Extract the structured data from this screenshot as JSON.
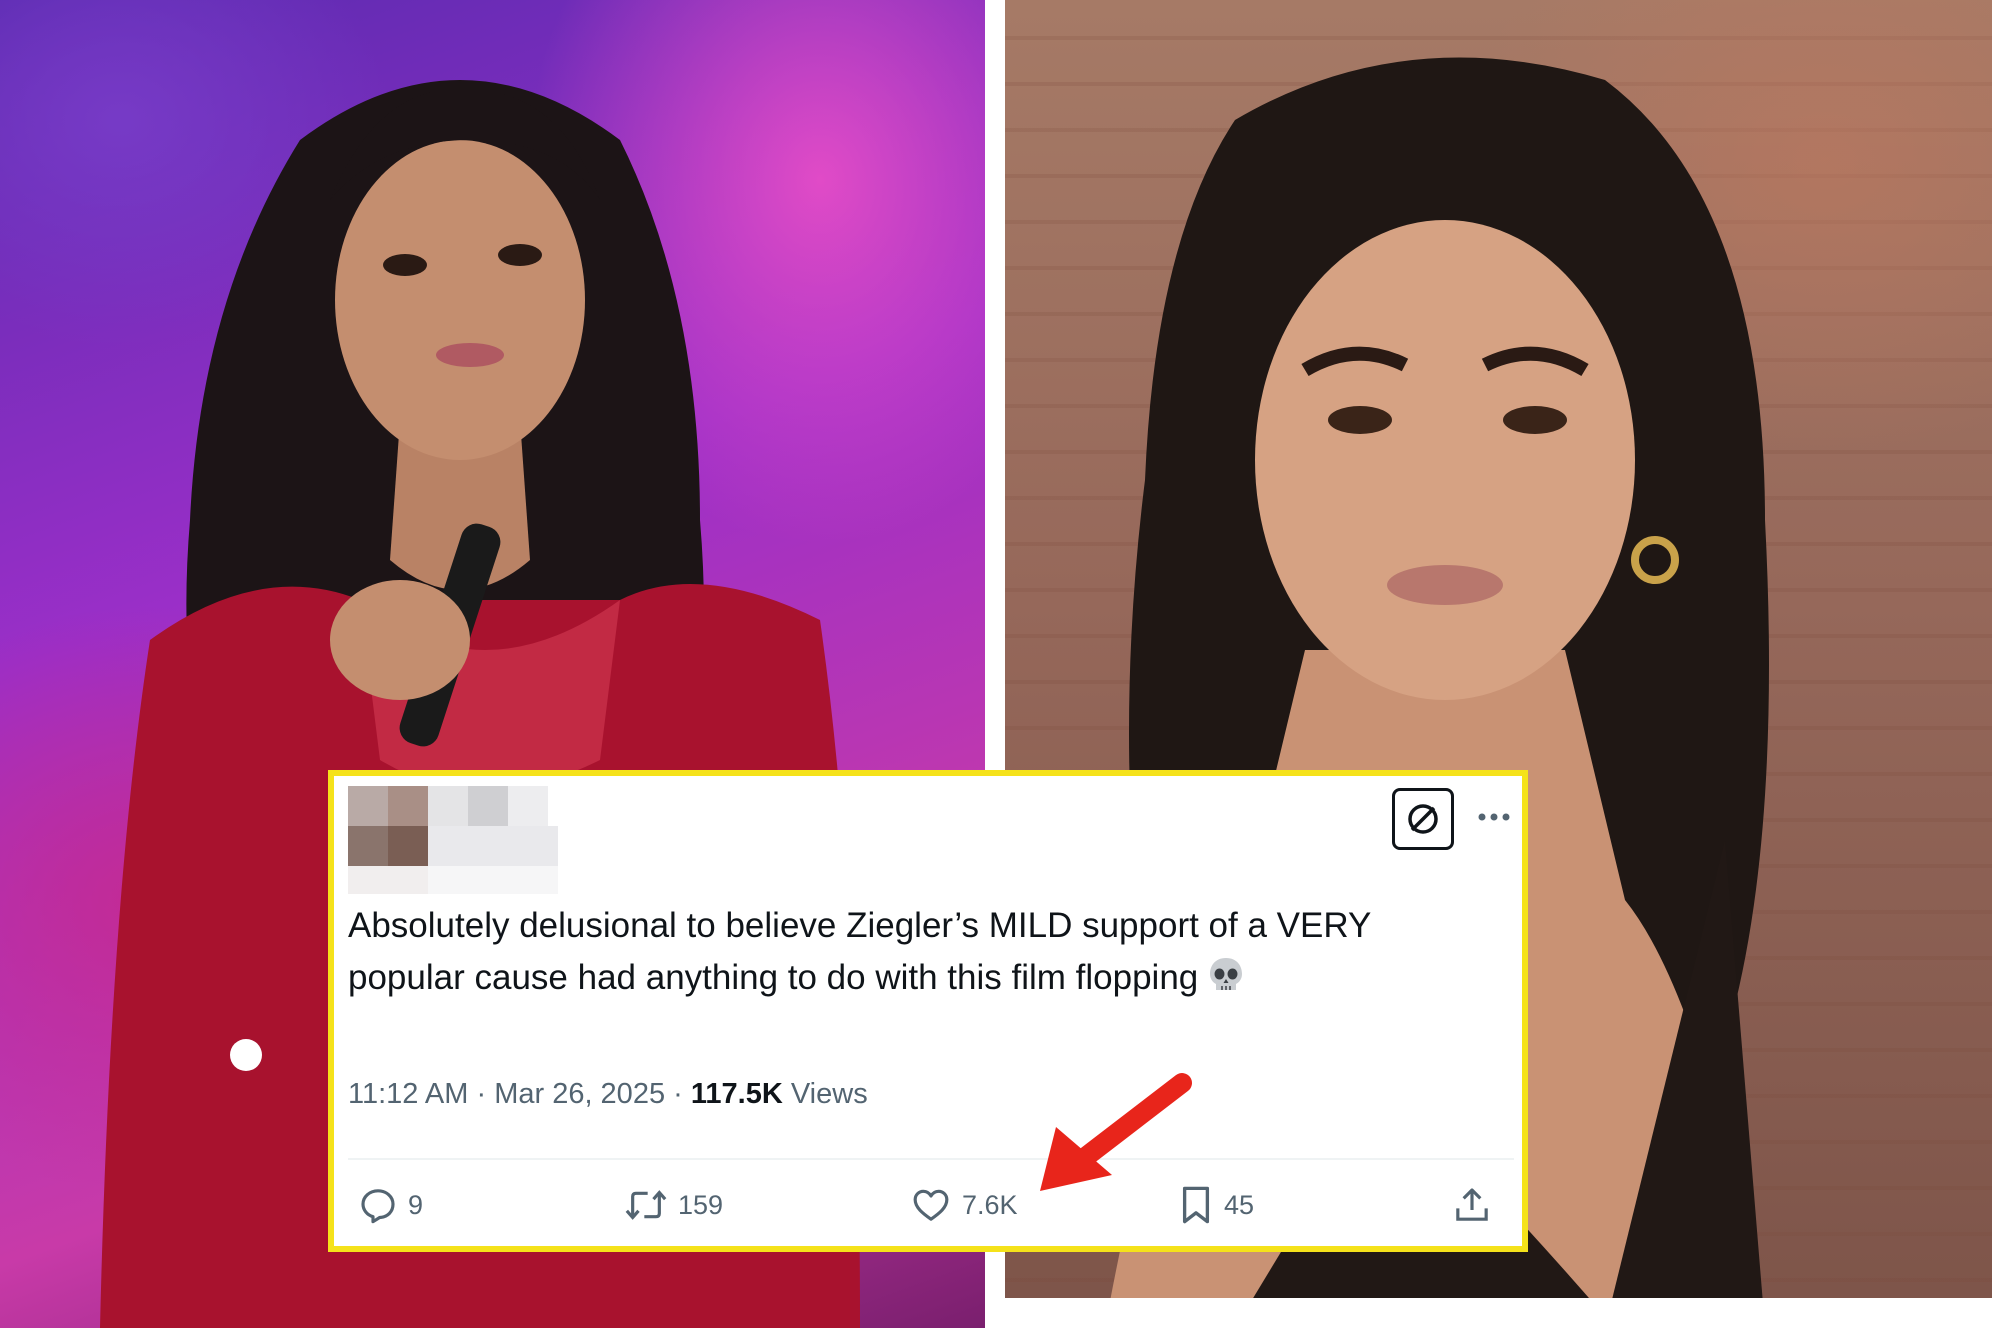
{
  "tweet": {
    "text_line1": "Absolutely delusional to believe Ziegler’s MILD support of a VERY",
    "text_line2": "popular cause had anything to do with this film flopping",
    "emoji_icon": "skull-emoji",
    "time": "11:12 AM",
    "date": "Mar 26, 2025",
    "separator": "·",
    "views_count": "117.5K",
    "views_label": "Views",
    "actions": {
      "replies": "9",
      "retweets": "159",
      "likes": "7.6K",
      "bookmarks": "45"
    }
  },
  "colors": {
    "card_border": "#f5e21a",
    "text": "#0f1419",
    "muted": "#536471",
    "arrow": "#e8251b"
  }
}
